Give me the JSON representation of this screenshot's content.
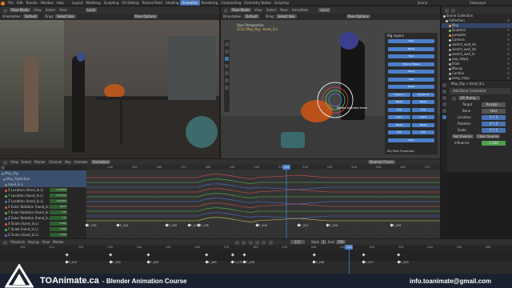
{
  "menu": {
    "items": [
      "File",
      "Edit",
      "Render",
      "Window",
      "Help",
      "Layout",
      "Modeling",
      "Sculpting",
      "UV Editing",
      "Texture Paint",
      "Shading",
      "Animation",
      "Rendering",
      "Compositing",
      "Geometry Nodes",
      "Scripting"
    ],
    "active": "Animation",
    "scene_label": "Scene",
    "view_layer_label": "ViewLayer"
  },
  "left_viewport": {
    "mode": "Pose Mode",
    "view": "View",
    "select": "Select",
    "pose": "Pose",
    "orientation_label": "Orientation:",
    "orientation_value": "Default",
    "drag_label": "Drag:",
    "drag_value": "Select Box",
    "transform": "Local",
    "overlay": "Pose Options"
  },
  "right_viewport": {
    "mode": "Pose Mode",
    "view": "View",
    "select": "Select",
    "pose": "Pose",
    "armature": "ArmaData",
    "orientation_label": "Orientation:",
    "orientation_value": "Default",
    "drag_label": "Drag:",
    "drag_value": "Select Box",
    "transform": "Local",
    "overlay": "Pose Options",
    "info_line1": "User Perspective",
    "info_line2": "(212) May_Rig : hand_ik.L",
    "tooltip": "Rotate selected items"
  },
  "rig_layers": {
    "title": "Rig Layers",
    "buttons": [
      "Face",
      "Tweak",
      "Hair",
      "Torso & Tweak",
      "Torso",
      "Sub",
      "Tweak",
      "Fingers.L",
      "Fingers.R",
      "Tweak",
      "Tweak",
      "Sub",
      "Sub",
      "Leg.L",
      "Leg.R",
      "Tweak",
      "Tweak",
      "Sub",
      "Sub",
      "Root"
    ],
    "footer": "Rig Main Properties"
  },
  "outliner": {
    "title": "Scene Collection",
    "rows": [
      "Collection",
      "May",
      "Quaterni",
      "pumpkin",
      "Camera",
      "sketch_wall_de",
      "sketch_wall_de",
      "sketch_wall_le",
      "asp_mtpcJ",
      "Floor",
      "Mocap",
      "Cambin",
      "lamp_mtpc",
      "Floor2"
    ]
  },
  "properties": {
    "header": "May_Rig",
    "bone": "hand_ik.L",
    "add_constraint": "Add Bone Constraint",
    "constraint_name": "OP_Pump...",
    "target_label": "Target",
    "target_value": "Pumpki...",
    "bone_label": "Bone",
    "bone_value": "Hnd",
    "location_label": "Location",
    "location_values": [
      "X",
      "Y",
      "Z"
    ],
    "rotation_label": "Rotation",
    "rotation_values": [
      "X",
      "Y",
      "Z"
    ],
    "scale_label": "Scale",
    "scale_values": [
      "X",
      "Y",
      "Z"
    ],
    "set_inverse": "Set Inverse",
    "clear_inverse": "Clear Inverse",
    "influence_label": "Influence",
    "influence_value": "1.000"
  },
  "graph_editor": {
    "menu": [
      "View",
      "Select",
      "Marker",
      "Channel",
      "Key",
      "Animate"
    ],
    "mode": "Animation",
    "normalize": "Nearest Frame",
    "current_frame": "212",
    "ticks": [
      "140",
      "150",
      "160",
      "170",
      "180",
      "190",
      "200",
      "210",
      "220",
      "230",
      "240",
      "250",
      "260",
      "270"
    ],
    "channels": [
      {
        "name": "May_Rig",
        "value": ""
      },
      {
        "name": "May_RigAction",
        "value": ""
      },
      {
        "name": "hand_ik.L",
        "value": ""
      },
      {
        "name": "X Location (hand_ik.L)",
        "value": "-0.19902"
      },
      {
        "name": "Y Location (hand_ik.L)",
        "value": "-0.17912"
      },
      {
        "name": "Z Location (hand_ik.L)",
        "value": "0.02767"
      },
      {
        "name": "X Euler Rotation (hand_ik.L)",
        "value": "98.7°"
      },
      {
        "name": "Y Euler Rotation (hand_ik.L)",
        "value": "-5.6°"
      },
      {
        "name": "Z Euler Rotation (hand_ik.L)",
        "value": "7.5°"
      },
      {
        "name": "X Scale (hand_ik.L)",
        "value": "1.000"
      },
      {
        "name": "Y Scale (hand_ik.L)",
        "value": "1.000"
      },
      {
        "name": "Z Scale (hand_ik.L)",
        "value": "1.000"
      },
      {
        "name": "Influence (hand_ik.L)",
        "value": "1.000"
      }
    ],
    "markers": [
      "F_130",
      "F_143",
      "F_163",
      "F_172",
      "F_176",
      "F_200",
      "F_217",
      "F_229",
      "F_255"
    ]
  },
  "timeline": {
    "menu": [
      "Playback",
      "Keying",
      "View",
      "Marker"
    ],
    "current_frame": "212",
    "start_label": "Start",
    "start_value": "1",
    "end_label": "End",
    "end_value": "356",
    "ticks": [
      "100",
      "110",
      "120",
      "130",
      "140",
      "150",
      "160",
      "170",
      "180",
      "190",
      "200",
      "210",
      "220",
      "230",
      "240",
      "250",
      "260"
    ],
    "markers": [
      "F_115",
      "F_130",
      "F_143",
      "F_163",
      "F_172",
      "F_176",
      "F_200",
      "F_217",
      "F_229"
    ]
  },
  "watermark": {
    "brand": "TOAnimate.ca",
    "course": " - Blender Animation Course",
    "email": "info.toanimate@gmail.com"
  },
  "colors": {
    "accent": "#4772b3",
    "playhead": "#4b7fc9",
    "marker": "#e6e6e6",
    "green_channel": "#2e5e2e"
  }
}
